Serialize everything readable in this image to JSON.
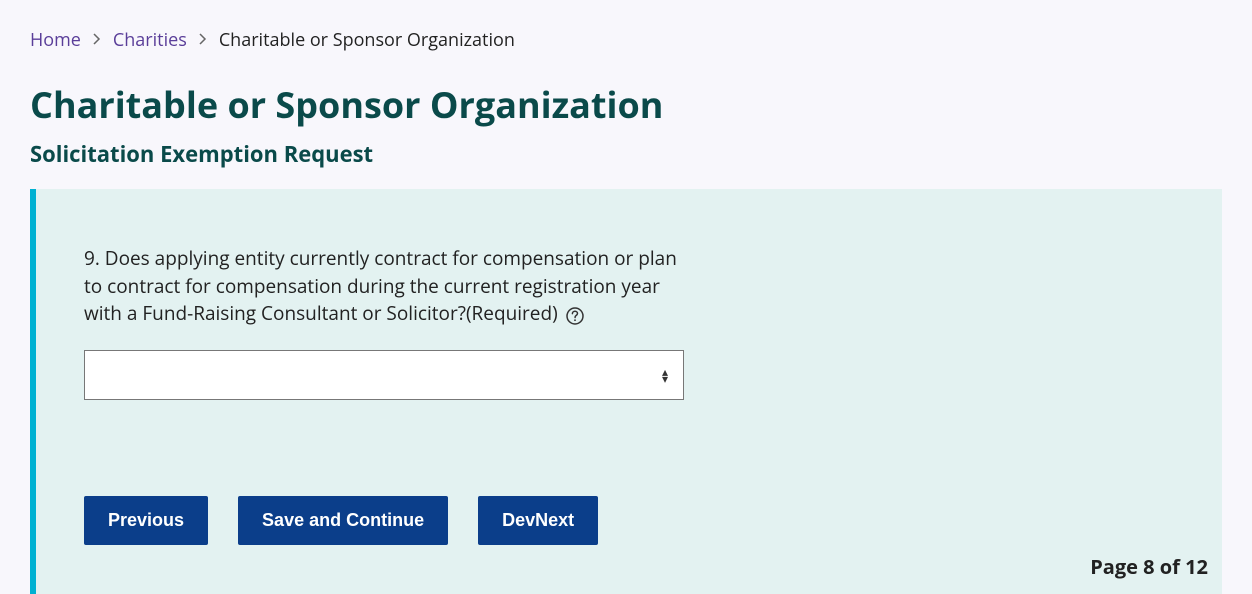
{
  "breadcrumb": {
    "items": [
      {
        "label": "Home"
      },
      {
        "label": "Charities"
      }
    ],
    "current": "Charitable or Sponsor Organization"
  },
  "page": {
    "title": "Charitable or Sponsor Organization",
    "subtitle": "Solicitation Exemption Request"
  },
  "question": {
    "text": "9. Does applying entity currently contract for compensation or plan to contract for compensation during the current registration year with a Fund-Raising Consultant or Solicitor?(Required)",
    "selected": ""
  },
  "buttons": {
    "previous": "Previous",
    "save_continue": "Save and Continue",
    "dev_next": "DevNext"
  },
  "pager": {
    "text": "Page 8 of 12"
  }
}
